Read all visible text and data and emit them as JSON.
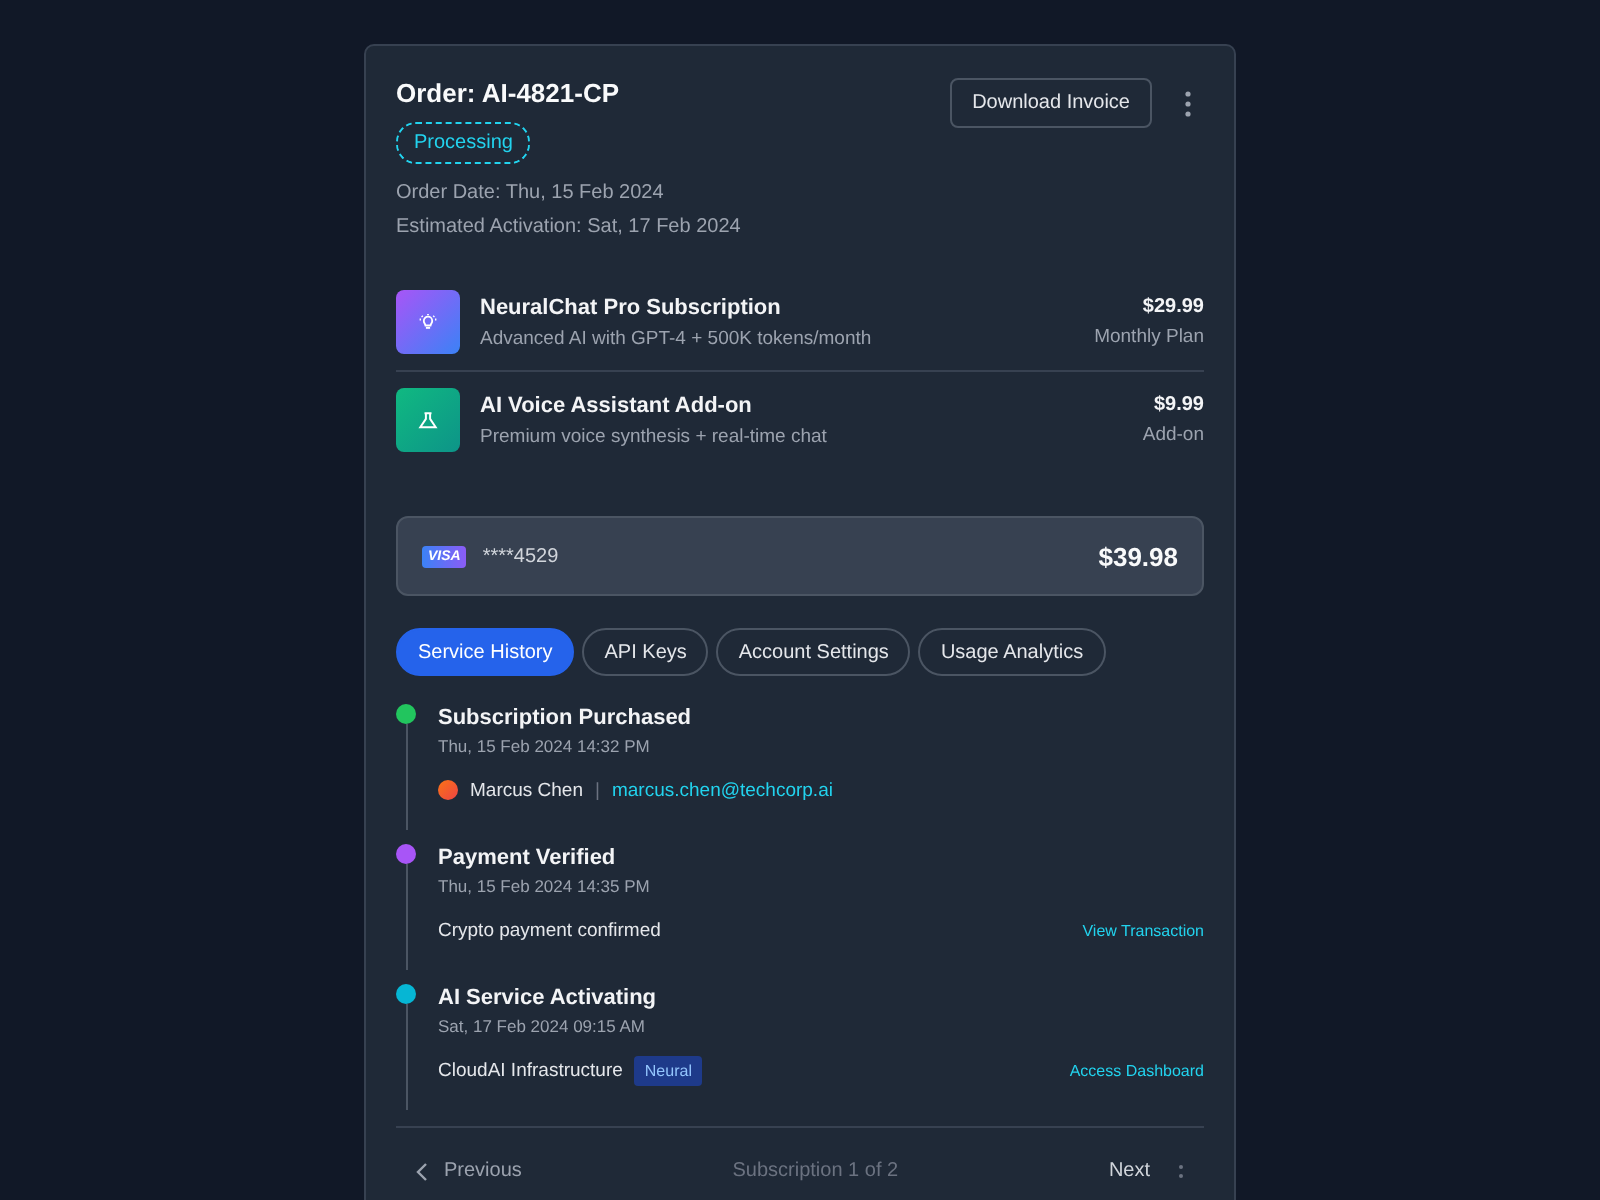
{
  "order": {
    "title": "Order: AI-4821-CP",
    "status": "Processing",
    "order_date": "Order Date: Thu, 15 Feb 2024",
    "activation": "Estimated Activation: Sat, 17 Feb 2024",
    "download_button": "Download Invoice"
  },
  "items": [
    {
      "name": "NeuralChat Pro Subscription",
      "description": "Advanced AI with GPT-4 + 500K tokens/month",
      "price": "$29.99",
      "plan": "Monthly Plan"
    },
    {
      "name": "AI Voice Assistant Add-on",
      "description": "Premium voice synthesis + real-time chat",
      "price": "$9.99",
      "plan": "Add-on"
    }
  ],
  "payment": {
    "brand": "VISA",
    "card": "****4529",
    "total": "$39.98"
  },
  "tabs": [
    {
      "label": "Service History",
      "selected": true
    },
    {
      "label": "API Keys",
      "selected": false
    },
    {
      "label": "Account Settings",
      "selected": false
    },
    {
      "label": "Usage Analytics",
      "selected": false
    }
  ],
  "events": [
    {
      "kind": "person",
      "title": "Subscription Purchased",
      "time": "Thu, 15 Feb 2024 14:32 PM",
      "color": "#22c55e",
      "name": "Marcus Chen",
      "separator": "|",
      "email": "marcus.chen@techcorp.ai"
    },
    {
      "kind": "note",
      "title": "Payment Verified",
      "time": "Thu, 15 Feb 2024 14:35 PM",
      "color": "#a855f7",
      "text": "Crypto payment confirmed",
      "link": "View Transaction"
    },
    {
      "kind": "tagged",
      "title": "AI Service Activating",
      "time": "Sat, 17 Feb 2024 09:15 AM",
      "color": "#06b6d4",
      "text": "CloudAI Infrastructure",
      "tag": "Neural",
      "link": "Access Dashboard"
    }
  ],
  "footer": {
    "previous": "Previous",
    "page": "Subscription 1 of 2",
    "next": "Next"
  }
}
